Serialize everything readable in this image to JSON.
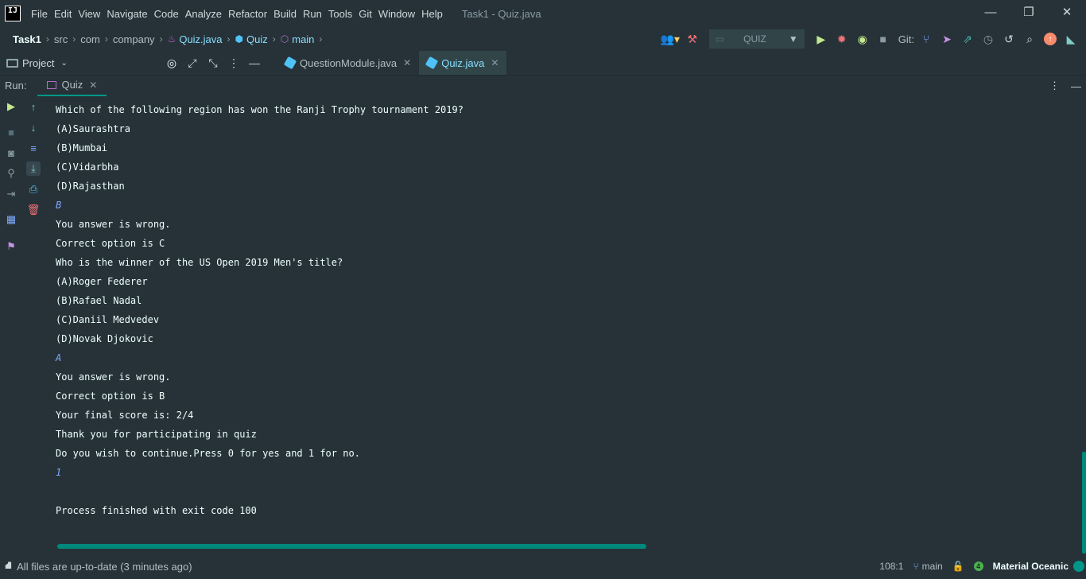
{
  "window": {
    "title": "Task1 - Quiz.java",
    "minimize": "—",
    "maximize": "❐",
    "close": "✕"
  },
  "menu": [
    "File",
    "Edit",
    "View",
    "Navigate",
    "Code",
    "Analyze",
    "Refactor",
    "Build",
    "Run",
    "Tools",
    "Git",
    "Window",
    "Help"
  ],
  "breadcrumb": {
    "items": [
      "Task1",
      "src",
      "com",
      "company",
      "Quiz.java",
      "Quiz",
      "main"
    ]
  },
  "toolbar": {
    "run_config": "QUIZ",
    "git_label": "Git:"
  },
  "project_panel": {
    "label": "Project"
  },
  "editor_tabs": [
    {
      "label": "QuestionModule.java",
      "active": false
    },
    {
      "label": "Quiz.java",
      "active": true
    }
  ],
  "run_panel": {
    "label": "Run:",
    "tab_label": "Quiz"
  },
  "console": {
    "lines": [
      {
        "text": "Which of the following region has won the Ranji Trophy tournament 2019?",
        "input": false
      },
      {
        "text": "(A)Saurashtra",
        "input": false
      },
      {
        "text": "(B)Mumbai",
        "input": false
      },
      {
        "text": "(C)Vidarbha",
        "input": false
      },
      {
        "text": "(D)Rajasthan",
        "input": false
      },
      {
        "text": "B",
        "input": true
      },
      {
        "text": "You answer is wrong.",
        "input": false
      },
      {
        "text": "Correct option is C",
        "input": false
      },
      {
        "text": "Who is the winner of the US Open 2019 Men's title?",
        "input": false
      },
      {
        "text": "(A)Roger Federer",
        "input": false
      },
      {
        "text": "(B)Rafael Nadal",
        "input": false
      },
      {
        "text": "(C)Daniil Medvedev",
        "input": false
      },
      {
        "text": "(D)Novak Djokovic",
        "input": false
      },
      {
        "text": "A",
        "input": true
      },
      {
        "text": "You answer is wrong.",
        "input": false
      },
      {
        "text": "Correct option is B",
        "input": false
      },
      {
        "text": "Your final score is: 2/4",
        "input": false
      },
      {
        "text": "Thank you for participating in quiz",
        "input": false
      },
      {
        "text": "Do you wish to continue.Press 0 for yes and 1 for no.",
        "input": false
      },
      {
        "text": "1",
        "input": true
      },
      {
        "text": "",
        "input": false
      },
      {
        "text": "Process finished with exit code 100",
        "input": false
      }
    ]
  },
  "status": {
    "message": "All files are up-to-date (3 minutes ago)",
    "position": "108:1",
    "branch": "main",
    "notifications": "4",
    "theme": "Material Oceanic"
  },
  "colors": {
    "background": "#263238",
    "accent": "#009688",
    "text": "#eeffff",
    "input_text": "#82aaff"
  }
}
